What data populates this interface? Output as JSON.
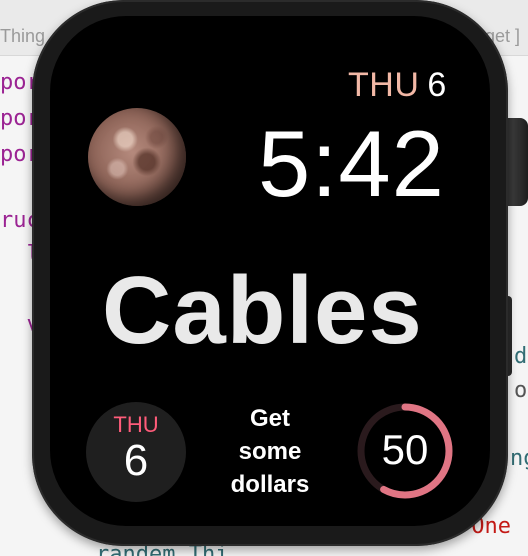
{
  "editor": {
    "tab_left": "Thing",
    "tab_right": "get ]",
    "lines": [
      "port",
      "port",
      "port",
      "ruc",
      "  l",
      "  v",
      "d",
      "or",
      "  -",
      "ngV",
      "\"One",
      "randem Thi"
    ]
  },
  "watch": {
    "date_day": "THU",
    "date_num": "6",
    "time": "5:42",
    "headline": "Cables",
    "complications": {
      "date": {
        "day": "THU",
        "num": "6"
      },
      "text": {
        "line1": "Get",
        "line2": "some",
        "line3": "dollars"
      },
      "ring": {
        "value": "50",
        "progress": 0.58
      }
    }
  },
  "colors": {
    "date_accent": "#f2b8a6",
    "ring_accent": "#e07584",
    "comp_day_accent": "#ff5c7a"
  }
}
